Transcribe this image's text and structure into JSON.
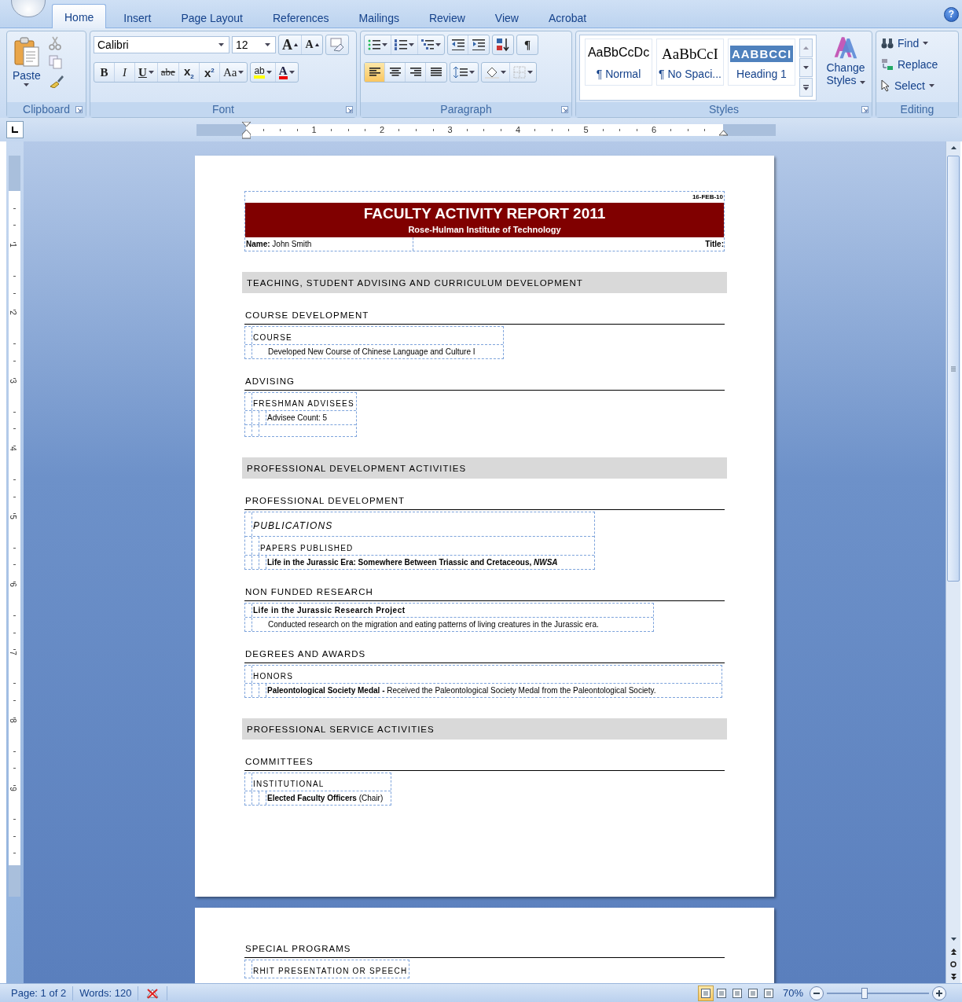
{
  "tabs": [
    {
      "label": "Home",
      "selected": true
    },
    {
      "label": "Insert",
      "selected": false
    },
    {
      "label": "Page Layout",
      "selected": false
    },
    {
      "label": "References",
      "selected": false
    },
    {
      "label": "Mailings",
      "selected": false
    },
    {
      "label": "Review",
      "selected": false
    },
    {
      "label": "View",
      "selected": false
    },
    {
      "label": "Acrobat",
      "selected": false
    }
  ],
  "help_label": "?",
  "clipboard": {
    "paste": "Paste",
    "label": "Clipboard"
  },
  "font": {
    "name": "Calibri",
    "size": "12",
    "label": "Font",
    "size_buttons": [
      {
        "kind": "grow",
        "label": "A"
      },
      {
        "kind": "shrink",
        "label": "A"
      }
    ],
    "format_buttons": [
      {
        "kind": "bold",
        "label": "B"
      },
      {
        "kind": "italic",
        "label": "I"
      },
      {
        "kind": "underline",
        "label": "U"
      },
      {
        "kind": "strike",
        "label": "abe"
      },
      {
        "kind": "sub",
        "label": "x$_{2}$"
      },
      {
        "kind": "super",
        "label": "x$^{2}$"
      },
      {
        "kind": "case",
        "label": "Aa"
      },
      {
        "kind": "highlight",
        "label": "ab"
      },
      {
        "kind": "color",
        "label": "A"
      }
    ]
  },
  "paragraph": {
    "label": "Paragraph",
    "pilcrow": "¶",
    "alignments": [
      {
        "selected": true
      },
      {
        "selected": false
      },
      {
        "selected": false
      },
      {
        "selected": false
      }
    ]
  },
  "styles": {
    "label": "Styles",
    "change": "Change Styles",
    "items": [
      {
        "kind": "normal",
        "preview": "AaBbCcDc",
        "name": "¶ Normal"
      },
      {
        "kind": "serif",
        "preview": "AaBbCcI",
        "name": "¶ No Spaci..."
      },
      {
        "kind": "heading",
        "preview": "AABBCCI",
        "name": "Heading 1"
      }
    ]
  },
  "editing": {
    "label": "Editing",
    "items": [
      {
        "kind": "find",
        "label": "Find"
      },
      {
        "kind": "replace",
        "label": "Replace"
      },
      {
        "kind": "select",
        "label": "Select"
      }
    ]
  },
  "hruler": [
    "1",
    "2",
    "3",
    "4",
    "5",
    "6"
  ],
  "vruler": [
    "1",
    "2",
    "3",
    "4",
    "5",
    "6",
    "7",
    "8",
    "9"
  ],
  "report": {
    "date": "16-FEB-10",
    "title": "FACULTY ACTIVITY REPORT 2011",
    "subtitle": "Rose-Hulman Institute of Technology",
    "name": "**Name:** John Smith",
    "title_label": "Title:"
  },
  "pages": [
    {
      "blocks": [
        {
          "kind": "band",
          "text": "TEACHING, STUDENT ADVISING AND CURRICULUM DEVELOPMENT"
        },
        {
          "kind": "subhead",
          "text": "COURSE DEVELOPMENT"
        },
        {
          "kind": "entry",
          "lines": [
            {
              "kind": "category",
              "text": "COURSE"
            },
            {
              "kind": "paragraph",
              "text": "Developed New Course of Chinese Language and Culture I"
            }
          ]
        },
        {
          "kind": "subhead",
          "text": "ADVISING"
        },
        {
          "kind": "entry",
          "lines": [
            {
              "kind": "category",
              "text": "FRESHMAN ADVISEES"
            },
            {
              "kind": "item",
              "text": "Advisee Count:  5"
            },
            {
              "kind": "blank"
            }
          ]
        },
        {
          "kind": "band",
          "text": "PROFESSIONAL DEVELOPMENT ACTIVITIES"
        },
        {
          "kind": "subhead",
          "text": "PROFESSIONAL DEVELOPMENT"
        },
        {
          "kind": "entry",
          "lines": [
            {
              "kind": "category-italic",
              "text": "PUBLICATIONS"
            },
            {
              "kind": "subcategory",
              "text": "PAPERS PUBLISHED"
            },
            {
              "kind": "item-bold",
              "text": "Life in the Jurassic Era: Somewhere Between Triassic and Cretaceous, *NWSA*"
            }
          ]
        },
        {
          "kind": "subhead",
          "text": "NON FUNDED RESEARCH"
        },
        {
          "kind": "entry",
          "lines": [
            {
              "kind": "title",
              "text": "Life in the Jurassic Research Project"
            },
            {
              "kind": "paragraph",
              "text": "Conducted research on the migration and eating patterns of living creatures in the Jurassic era."
            }
          ]
        },
        {
          "kind": "subhead",
          "text": "DEGREES AND AWARDS"
        },
        {
          "kind": "entry",
          "lines": [
            {
              "kind": "category",
              "text": "HONORS"
            },
            {
              "kind": "item",
              "text": "**Paleontological  Society Medal -** Received the Paleontological  Society Medal from the Paleontological Society."
            }
          ]
        },
        {
          "kind": "band",
          "text": "PROFESSIONAL SERVICE ACTIVITIES"
        },
        {
          "kind": "subhead",
          "text": "COMMITTEES"
        },
        {
          "kind": "entry",
          "lines": [
            {
              "kind": "category",
              "text": "INSTITUTIONAL"
            },
            {
              "kind": "item",
              "text": "**Elected Faculty Officers** (Chair)"
            }
          ]
        }
      ]
    },
    {
      "blocks": [
        {
          "kind": "subhead",
          "text": "SPECIAL PROGRAMS"
        },
        {
          "kind": "entry",
          "lines": [
            {
              "kind": "category",
              "text": "RHIT PRESENTATION OR SPEECH"
            }
          ]
        }
      ]
    }
  ],
  "status": {
    "page": "Page: 1 of 2",
    "words": "Words: 120",
    "zoom": "70%",
    "zoom_slider": {
      "level": 0.37
    },
    "views": [
      {
        "selected": true
      },
      {
        "selected": false
      },
      {
        "selected": false
      },
      {
        "selected": false
      },
      {
        "selected": false
      }
    ]
  }
}
